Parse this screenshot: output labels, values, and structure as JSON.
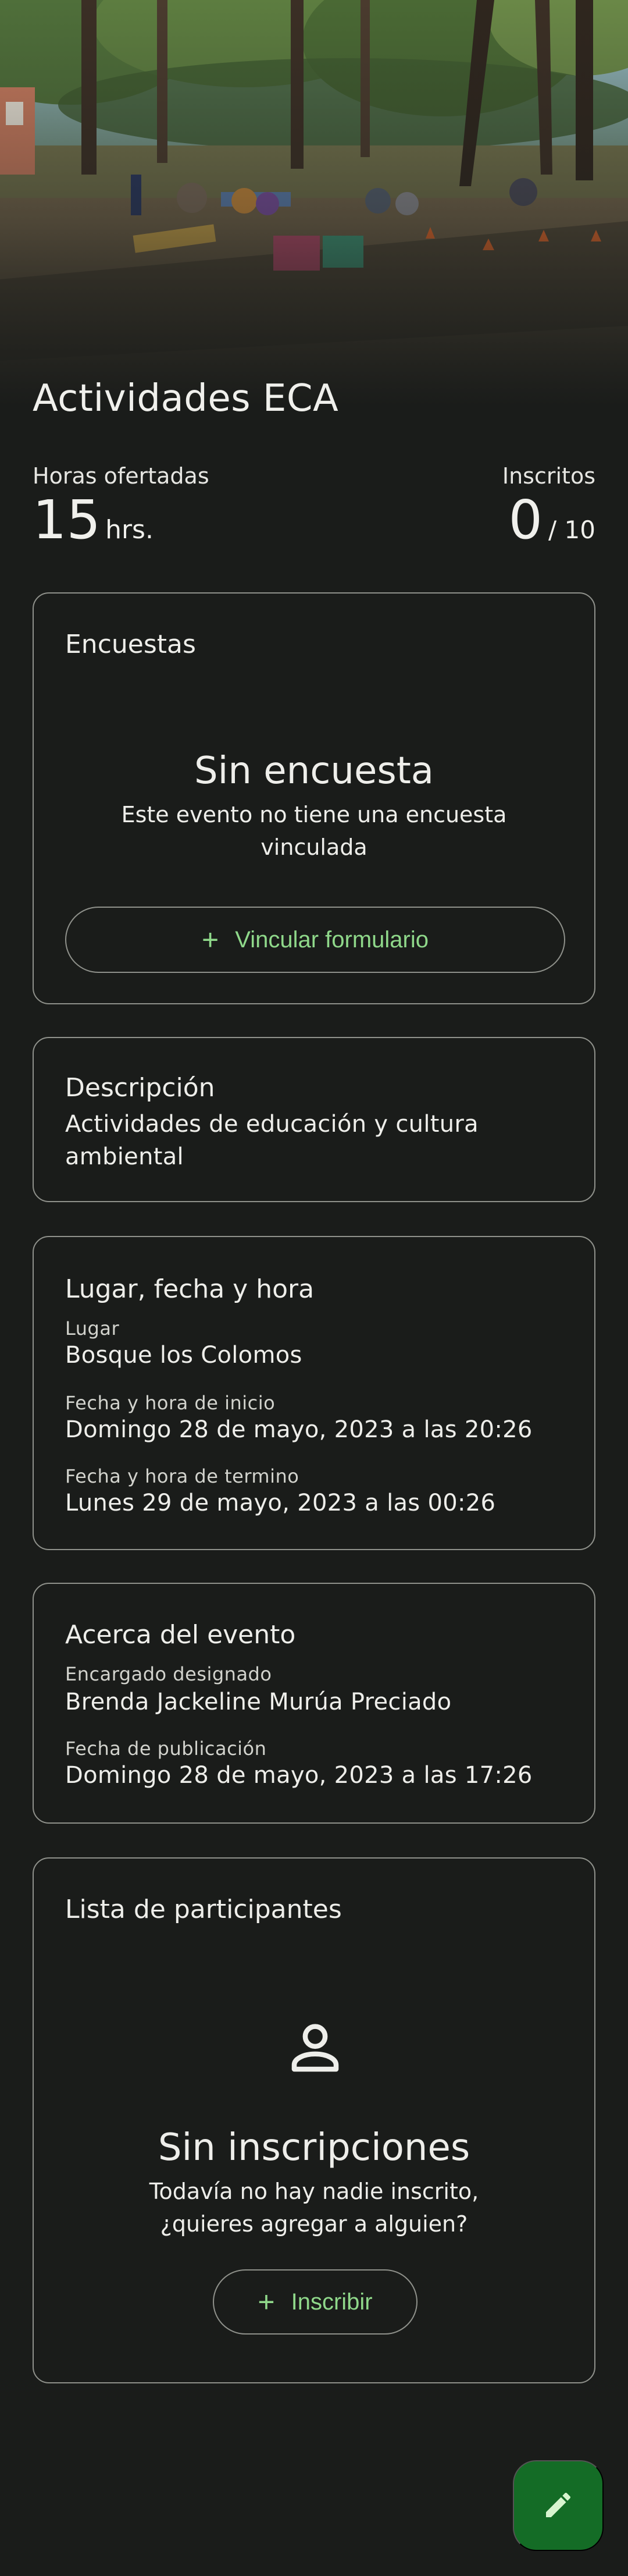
{
  "event": {
    "title": "Actividades ECA",
    "hours_label": "Horas ofertadas",
    "hours_value": "15",
    "hours_unit": "hrs.",
    "inscribed_label": "Inscritos",
    "inscribed_value": "0",
    "inscribed_capacity": "/ 10"
  },
  "surveys": {
    "title": "Encuestas",
    "empty_title": "Sin encuesta",
    "empty_text": "Este evento no tiene una encuesta vinculada",
    "button_label": "Vincular formulario"
  },
  "description": {
    "title": "Descripción",
    "text": "Actividades de educación y cultura ambiental"
  },
  "place_time": {
    "title": "Lugar, fecha y hora",
    "place_label": "Lugar",
    "place_value": "Bosque los Colomos",
    "start_label": "Fecha y hora de inicio",
    "start_value": "Domingo 28 de mayo, 2023 a las 20:26",
    "end_label": "Fecha y hora de termino",
    "end_value": "Lunes 29 de mayo, 2023 a las 00:26"
  },
  "about": {
    "title": "Acerca del evento",
    "manager_label": "Encargado designado",
    "manager_value": "Brenda Jackeline Murúa Preciado",
    "published_label": "Fecha de publicación",
    "published_value": "Domingo 28 de mayo, 2023 a las 17:26"
  },
  "participants": {
    "title": "Lista de participantes",
    "empty_title": "Sin inscripciones",
    "empty_text": "Todavía no hay nadie inscrito, ¿quieres agregar a alguien?",
    "button_label": "Inscribir"
  },
  "colors": {
    "background": "#1a1c1a",
    "accent": "#8fd88a",
    "fab": "#146c26",
    "border": "#8f918b"
  },
  "icons": {
    "fab": "pencil-icon",
    "empty_participants": "person-icon",
    "add": "plus-icon"
  }
}
